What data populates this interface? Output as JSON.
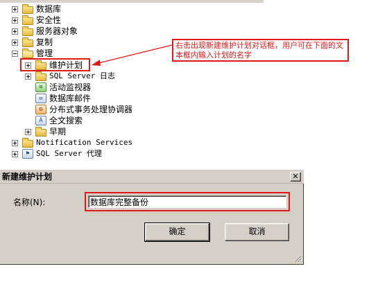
{
  "tree": {
    "items": [
      {
        "label": "数据库",
        "expander": "plus"
      },
      {
        "label": "安全性",
        "expander": "plus"
      },
      {
        "label": "服务器对象",
        "expander": "plus"
      },
      {
        "label": "复制",
        "expander": "plus"
      },
      {
        "label": "管理",
        "expander": "minus"
      },
      {
        "label": "维护计划",
        "expander": "plus"
      },
      {
        "label": "SQL Server 日志",
        "expander": "plus"
      },
      {
        "label": "活动监视器",
        "expander": "none"
      },
      {
        "label": "数据库邮件",
        "expander": "none"
      },
      {
        "label": "分布式事务处理协调器",
        "expander": "none"
      },
      {
        "label": "全文搜索",
        "expander": "none"
      },
      {
        "label": "早期",
        "expander": "plus"
      },
      {
        "label": "Notification Services",
        "expander": "plus"
      },
      {
        "label": "SQL Server 代理",
        "expander": "plus"
      }
    ]
  },
  "annotation": {
    "text": "右击出现新建维护计划对话框，用户可在下面的文本框内输入计划的名字",
    "color": "#e01818"
  },
  "dialog": {
    "title": "新建维护计划",
    "close_label": "✕",
    "name_label": "名称(N):",
    "name_value": "数据库完整备份",
    "ok_label": "确定",
    "cancel_label": "取消"
  },
  "icons": {
    "folder": "folder-icon",
    "activity_monitor": "activity-monitor-icon",
    "database_mail": "database-mail-icon",
    "dtc": "dtc-icon",
    "fulltext": "fulltext-search-icon",
    "agent": "sql-agent-icon"
  }
}
